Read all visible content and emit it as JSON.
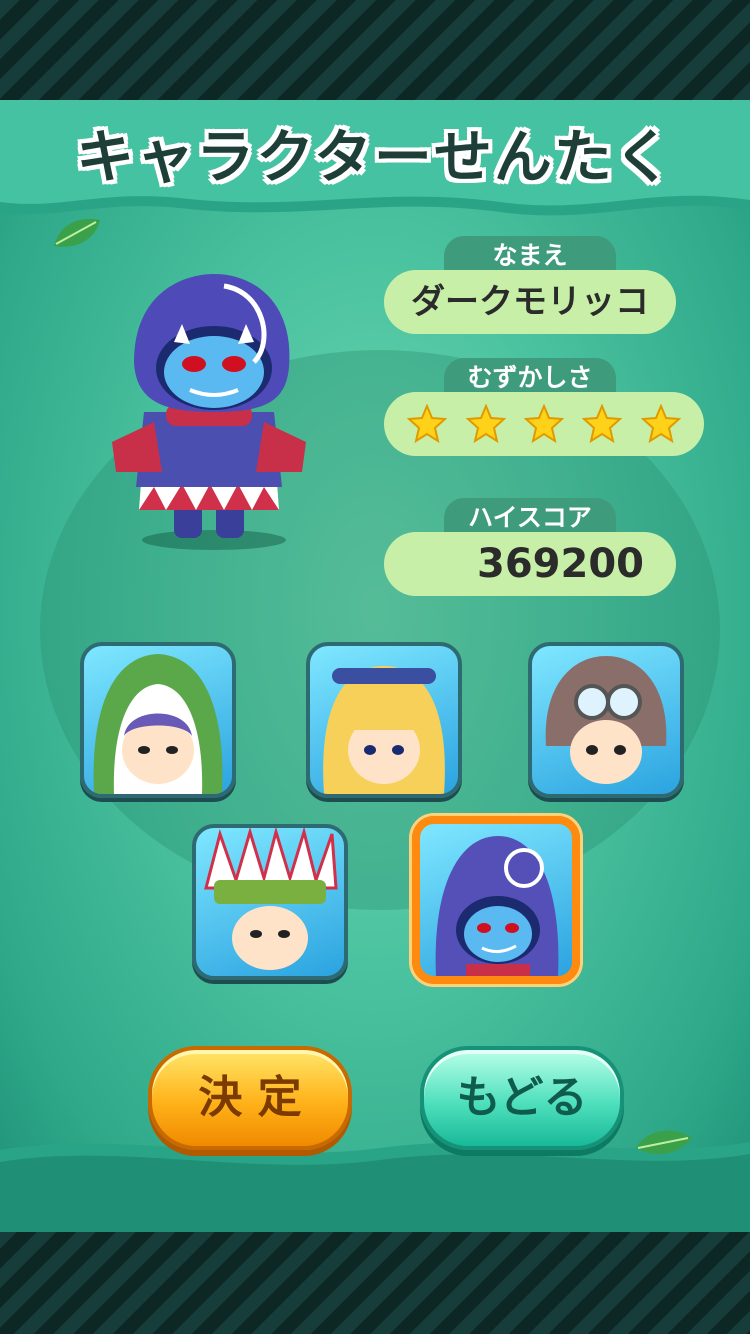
{
  "title": "キャラクターせんたく",
  "info": {
    "name_label": "なまえ",
    "name_value": "ダークモリッコ",
    "difficulty_label": "むずかしさ",
    "difficulty_stars": 5,
    "difficulty_max": 5,
    "highscore_label": "ハイスコア",
    "highscore_value": "369200"
  },
  "characters": [
    {
      "name": "green-hood-character",
      "selected": false
    },
    {
      "name": "blonde-hairband-character",
      "selected": false
    },
    {
      "name": "aviator-goggles-character",
      "selected": false
    },
    {
      "name": "feather-headdress-character",
      "selected": false
    },
    {
      "name": "dark-hood-character",
      "selected": true
    }
  ],
  "buttons": {
    "decide_label": "決 定",
    "back_label": "もどる"
  },
  "colors": {
    "panel": "#4cc3a0",
    "label_bg": "#3e9b7c",
    "field_bg": "#c8efa8",
    "star": "#ffd21a",
    "selected_border": "#ff8a10",
    "decide": "#ffb21a",
    "back": "#4fe0bd"
  }
}
